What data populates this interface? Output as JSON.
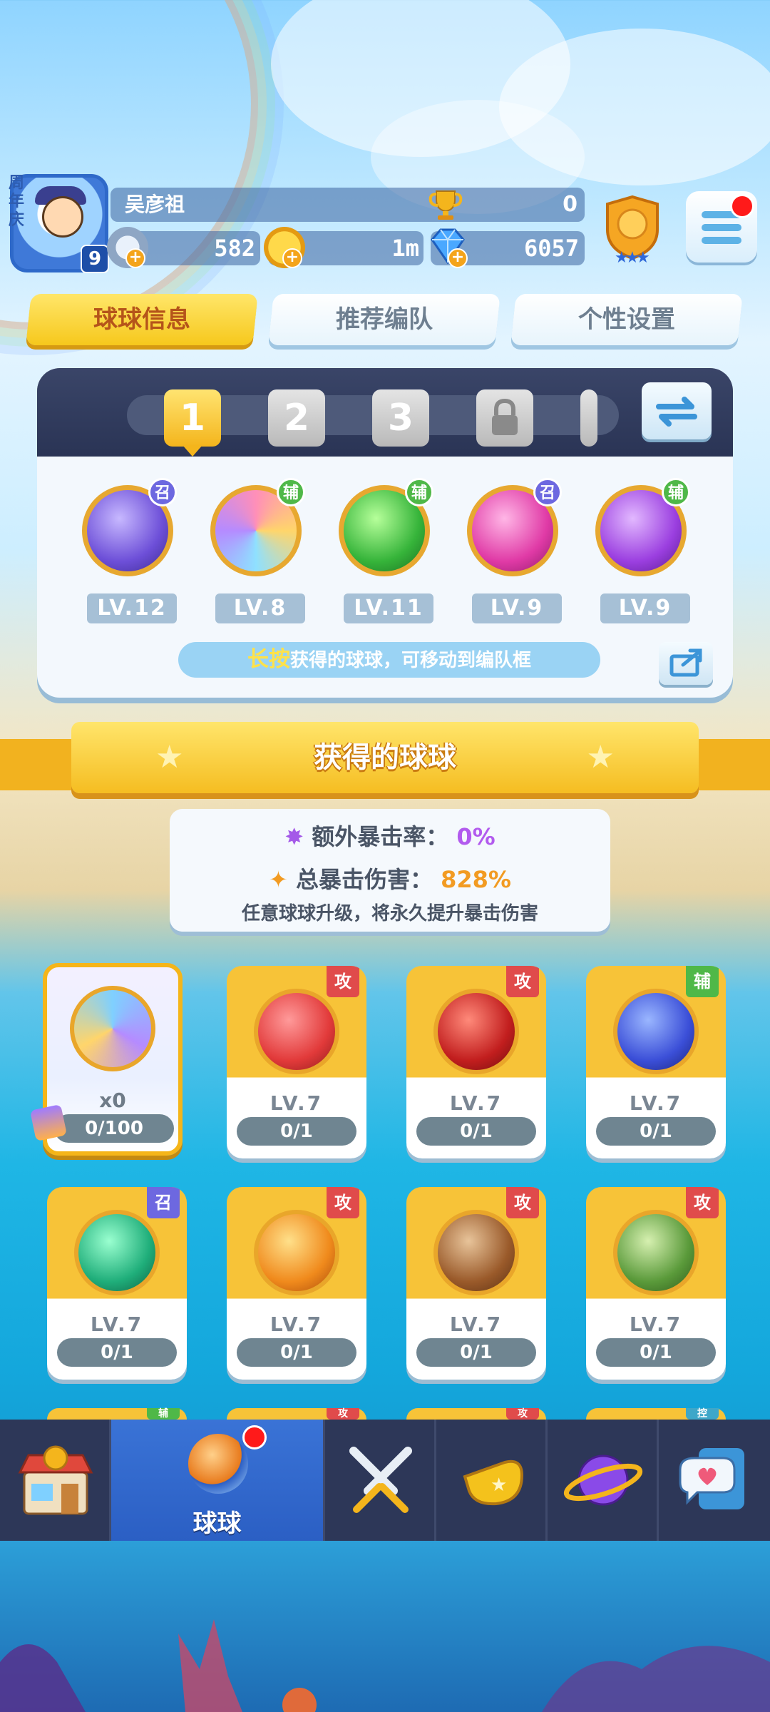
{
  "header": {
    "anniversary_label": "周年庆",
    "avatar_level": "9",
    "player_name": "吴彦祖",
    "trophies": "0",
    "stamina": "582",
    "coins": "1m",
    "gems": "6057",
    "rank_stars": 3
  },
  "tabs": [
    {
      "label": "球球信息",
      "active": true
    },
    {
      "label": "推荐编队",
      "active": false
    },
    {
      "label": "个性设置",
      "active": false
    }
  ],
  "team": {
    "slots": [
      "1",
      "2",
      "3"
    ],
    "selected_slot": "1",
    "members": [
      {
        "level": "LV.12",
        "role": "召",
        "icon": "ghost-ball-icon"
      },
      {
        "level": "LV.8",
        "role": "辅",
        "icon": "family-ball-icon"
      },
      {
        "level": "LV.11",
        "role": "辅",
        "icon": "arrow-ball-icon"
      },
      {
        "level": "LV.9",
        "role": "召",
        "icon": "feather-ball-icon"
      },
      {
        "level": "LV.9",
        "role": "辅",
        "icon": "sprout-ball-icon"
      }
    ],
    "hint_highlight": "长按",
    "hint_text": "获得的球球，可移动到编队框"
  },
  "collection": {
    "title": "获得的球球",
    "extra_crit_label": "额外暴击率：",
    "extra_crit_value": "0%",
    "total_crit_label": "总暴击伤害：",
    "total_crit_value": "828%",
    "note": "任意球球升级，将永久提升暴击伤害"
  },
  "cards": [
    {
      "special": true,
      "qty": "x0",
      "progress": "0/100",
      "icon": "refresh-ball-icon"
    },
    {
      "role": "攻",
      "level": "LV.7",
      "progress": "0/1",
      "icon": "red-slime-ball-icon"
    },
    {
      "role": "攻",
      "level": "LV.7",
      "progress": "0/1",
      "icon": "trident-ball-icon"
    },
    {
      "role": "辅",
      "level": "LV.7",
      "progress": "0/1",
      "icon": "hex-planet-ball-icon"
    },
    {
      "role": "召",
      "level": "LV.7",
      "progress": "0/1",
      "icon": "portal-ball-icon"
    },
    {
      "role": "攻",
      "level": "LV.7",
      "progress": "0/1",
      "icon": "fire-ball-icon"
    },
    {
      "role": "攻",
      "level": "LV.7",
      "progress": "0/1",
      "icon": "bear-ball-icon"
    },
    {
      "role": "攻",
      "level": "LV.7",
      "progress": "0/1",
      "icon": "ranger-ball-icon"
    }
  ],
  "partial_row_tags": [
    "辅",
    "攻",
    "攻",
    "控"
  ],
  "nav": [
    {
      "label": "",
      "icon": "shop-icon"
    },
    {
      "label": "球球",
      "icon": "ball-icon",
      "active": true
    },
    {
      "label": "",
      "icon": "swords-icon"
    },
    {
      "label": "",
      "icon": "whistle-icon"
    },
    {
      "label": "",
      "icon": "planet-icon"
    },
    {
      "label": "",
      "icon": "chat-heart-icon"
    }
  ],
  "colors": {
    "attack_tag": "#e04b4b",
    "support_tag": "#4fb848",
    "summon_tag": "#6d68e0",
    "control_tag": "#3ea7c9",
    "accent_yellow": "#f6c81c"
  }
}
